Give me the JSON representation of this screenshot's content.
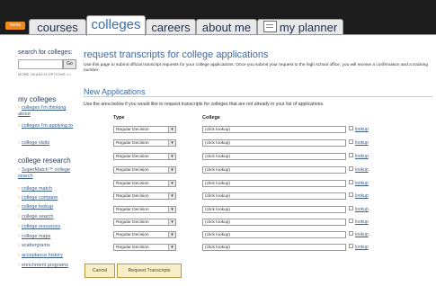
{
  "nav": {
    "home_label": "home",
    "tabs": [
      {
        "label": "courses"
      },
      {
        "label": "colleges"
      },
      {
        "label": "careers"
      },
      {
        "label": "about me"
      },
      {
        "label": "my planner"
      }
    ]
  },
  "sidebar": {
    "search_label": "search for colleges:",
    "go_label": "Go",
    "advanced_label": "MORE SEARCH OPTIONS >>",
    "my_colleges": {
      "heading": "my colleges",
      "items": [
        "colleges I'm thinking about",
        "colleges I'm applying to",
        "college visits"
      ]
    },
    "college_research": {
      "heading": "college research",
      "items": [
        "SuperMatch™ college search",
        "college match",
        "college compare",
        "college lookup",
        "college search",
        "college resources",
        "college maps",
        "scattergrams",
        "acceptance history",
        "enrichment programs"
      ]
    }
  },
  "main": {
    "title": "request transcripts for college applications",
    "description": "Use this page to submit official transcript requests for your college applications. Once you submit your request to the high school office, you will receive a confirmation and a tracking number.",
    "section_title": "New Applications",
    "section_desc": "Use the area below if you would like to request transcripts for colleges that are not already in your list of applications.",
    "col_type": "Type",
    "col_college": "College",
    "rows": [
      {
        "type": "Regular Decision",
        "college": "(click lookup)",
        "lookup": "lookup"
      },
      {
        "type": "Regular Decision",
        "college": "(click lookup)",
        "lookup": "lookup"
      },
      {
        "type": "Regular Decision",
        "college": "(click lookup)",
        "lookup": "lookup"
      },
      {
        "type": "Regular Decision",
        "college": "(click lookup)",
        "lookup": "lookup"
      },
      {
        "type": "Regular Decision",
        "college": "(click lookup)",
        "lookup": "lookup"
      },
      {
        "type": "Regular Decision",
        "college": "(click lookup)",
        "lookup": "lookup"
      },
      {
        "type": "Regular Decision",
        "college": "(click lookup)",
        "lookup": "lookup"
      },
      {
        "type": "Regular Decision",
        "college": "(click lookup)",
        "lookup": "lookup"
      },
      {
        "type": "Regular Decision",
        "college": "(click lookup)",
        "lookup": "lookup"
      },
      {
        "type": "Regular Decision",
        "college": "(click lookup)",
        "lookup": "lookup"
      }
    ],
    "cancel_label": "Cancel",
    "submit_label": "Request Transcripts"
  },
  "colors": {
    "accent": "#3d6aa0",
    "nav_bg": "#1c1c1c",
    "home": "#f08a1c",
    "arrow": "#f0a020",
    "button_bg": "#f8eec8"
  }
}
